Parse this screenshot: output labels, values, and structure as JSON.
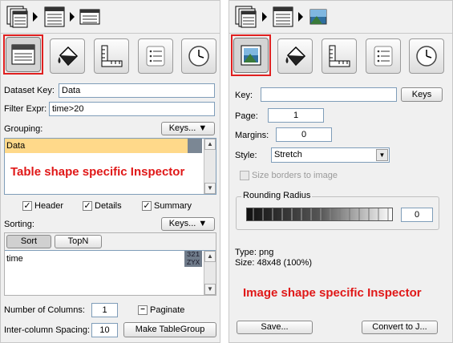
{
  "left": {
    "breadcrumb": [
      "table-list-icon",
      "table-icon",
      "table-small-icon"
    ],
    "toolbar": [
      "table-shape-icon",
      "paint-bucket-icon",
      "ruler-icon",
      "list-icon",
      "clock-icon"
    ],
    "dataset_key_label": "Dataset Key:",
    "dataset_key_value": "Data",
    "filter_label": "Filter Expr:",
    "filter_value": "time>20",
    "grouping_label": "Grouping:",
    "keys_button": "Keys...",
    "grouping_items": [
      "Data"
    ],
    "annotation": "Table shape specific Inspector",
    "checkboxes": [
      {
        "label": "Header",
        "checked": true
      },
      {
        "label": "Details",
        "checked": true
      },
      {
        "label": "Summary",
        "checked": true
      }
    ],
    "sorting_label": "Sorting:",
    "sorting_keys_button": "Keys...",
    "sort_tabs": [
      "Sort",
      "TopN"
    ],
    "sort_items": [
      "time"
    ],
    "sort_badge_top": "321",
    "sort_badge_bottom": "ZYX",
    "num_columns_label": "Number of Columns:",
    "num_columns_value": "1",
    "paginate_label": "Paginate",
    "spacing_label": "Inter-column Spacing:",
    "spacing_value": "10",
    "make_tablegroup_button": "Make TableGroup"
  },
  "right": {
    "breadcrumb": [
      "table-list-icon",
      "table-icon",
      "image-icon"
    ],
    "toolbar": [
      "image-shape-icon",
      "paint-bucket-icon",
      "ruler-icon",
      "list-icon",
      "clock-icon"
    ],
    "key_label": "Key:",
    "key_value": "",
    "keys_button": "Keys",
    "page_label": "Page:",
    "page_value": "1",
    "margins_label": "Margins:",
    "margins_value": "0",
    "style_label": "Style:",
    "style_value": "Stretch",
    "size_borders_label": "Size borders to image",
    "rounding_label": "Rounding Radius",
    "rounding_value": "0",
    "type_text": "Type: png",
    "size_text": "Size: 48x48 (100%)",
    "annotation": "Image shape specific Inspector",
    "save_button": "Save...",
    "convert_button": "Convert to J..."
  },
  "colors": {
    "highlight": "#e02020",
    "selection": "#ffd98a",
    "annotation": "#e01818"
  }
}
